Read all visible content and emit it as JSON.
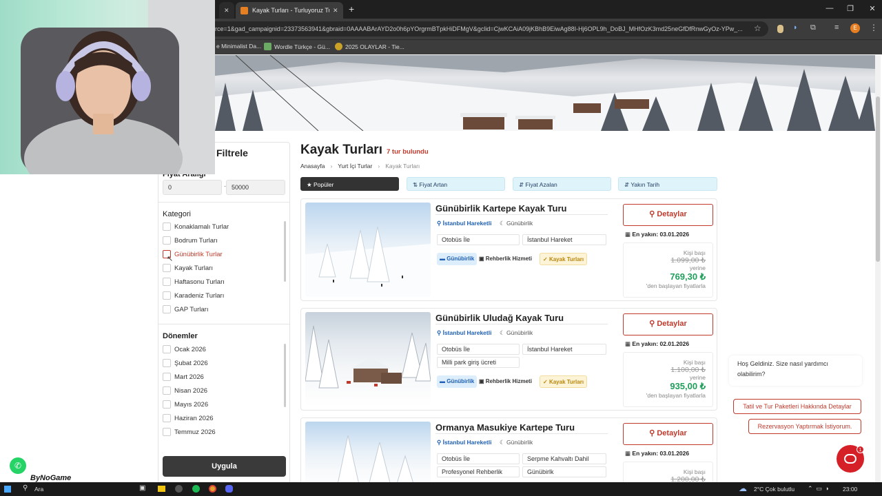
{
  "browser": {
    "tab_title": "Kayak Turları - Turluyoruz Turiz",
    "url": "rce=1&gad_campaignid=23373563941&gbraid=0AAAABArAYD2o0h6pYOrgrmBTpkHiDFMgV&gclid=CjwKCAiA09jKBhB9EiwAg88I-Hj6OPL9h_DoBJ_MHfOzK3md25neGfDfRnwGyOz-YPw_...",
    "bookmarks": [
      "e Minimalist Da...",
      "Wordle Türkçe - Gü...",
      "2025 OLAYLAR - Tie..."
    ],
    "profile_initial": "E"
  },
  "filter": {
    "title": "Filtrele",
    "price_label": "Fiyat Aralığı",
    "price_min": "0",
    "price_max": "50000",
    "category_title": "Kategori",
    "categories": [
      "Konaklamalı Turlar",
      "Bodrum Turları",
      "Günübirlik Turlar",
      "Kayak Turları",
      "Haftasonu Turları",
      "Karadeniz Turları",
      "GAP Turları"
    ],
    "period_title": "Dönemler",
    "periods": [
      "Ocak 2026",
      "Şubat 2026",
      "Mart 2026",
      "Nisan 2026",
      "Mayıs 2026",
      "Haziran 2026",
      "Temmuz 2026"
    ],
    "apply_label": "Uygula"
  },
  "main": {
    "title": "Kayak Turları",
    "count": "7 tur bulundu",
    "breadcrumb": [
      "Anasayfa",
      "Yurt İçi Turlar",
      "Kayak Turları"
    ],
    "sort": [
      "Popüler",
      "Fiyat Artan",
      "Fiyat Azalan",
      "Yakın Tarih"
    ],
    "tours": [
      {
        "title": "Günübirlik Kartepe Kayak Turu",
        "from": "İstanbul Hareketli",
        "duration": "Günübirlik",
        "features": [
          "Otobüs İle",
          "İstanbul Hareket"
        ],
        "tags": [
          "Günübirlik",
          "Rehberlik Hizmeti",
          "Kayak Turları"
        ],
        "detail_label": "Detaylar",
        "nearest": "En yakın: 03.01.2026",
        "per_person": "Kişi başı",
        "old_price": "1.099,00 ₺",
        "instead": "yerine",
        "price": "769,30 ₺",
        "starting": "'den başlayan fiyatlarla"
      },
      {
        "title": "Günübirlik Uludağ Kayak Turu",
        "from": "İstanbul Hareketli",
        "duration": "Günübirlik",
        "features": [
          "Otobüs İle",
          "İstanbul Hareket",
          "Milli park giriş ücreti"
        ],
        "tags": [
          "Günübirlik",
          "Rehberlik Hizmeti",
          "Kayak Turları"
        ],
        "detail_label": "Detaylar",
        "nearest": "En yakın: 02.01.2026",
        "per_person": "Kişi başı",
        "old_price": "1.100,00 ₺",
        "instead": "yerine",
        "price": "935,00 ₺",
        "starting": "'den başlayan fiyatlarla"
      },
      {
        "title": "Ormanya Masukiye Kartepe Turu",
        "from": "İstanbul Hareketli",
        "duration": "Günübirlik",
        "features": [
          "Otobüs İle",
          "Serpme Kahvaltı Dahil",
          "Profesyonel Rehberlik",
          "Günübirlk"
        ],
        "detail_label": "Detaylar",
        "nearest": "En yakın: 03.01.2026",
        "per_person": "Kişi başı",
        "old_price": "1.200,00 ₺"
      }
    ]
  },
  "chat": {
    "message": "Hoş Geldiniz. Size nasıl yardımcı olabilirim?",
    "option1": "Tatil ve Tur Paketleri Hakkında Detaylar",
    "option2": "Rezervasyon Yaptırmak İstiyorum.",
    "badge": "1"
  },
  "overlay": {
    "logo_text": "ByNoGame"
  },
  "taskbar": {
    "search": "Ara",
    "weather": "2°C  Çok bulutlu",
    "clock": "23:00"
  },
  "colors": {
    "accent": "#c0392b",
    "price_green": "#1e9e5a",
    "link_blue": "#1e5fb3"
  }
}
